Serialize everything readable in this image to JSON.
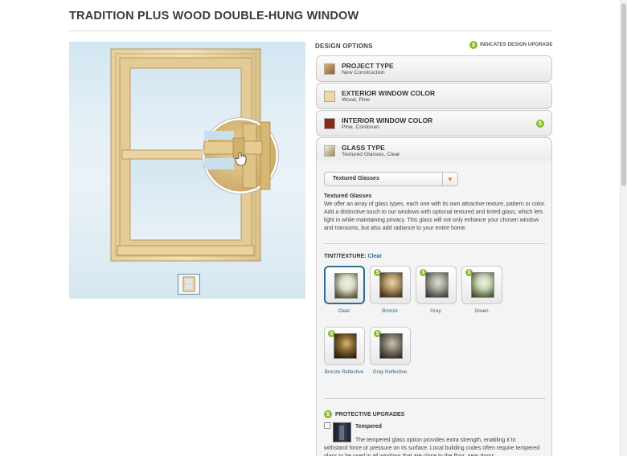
{
  "page": {
    "title": "TRADITION PLUS WOOD DOUBLE-HUNG WINDOW"
  },
  "design_options": {
    "label": "DESIGN OPTIONS",
    "upgrade_legend": "INDICATES DESIGN UPGRADE",
    "upgrade_symbol": "$"
  },
  "accordion": [
    {
      "title": "PROJECT TYPE",
      "value": "New Construction",
      "swatch": "#b48a5a",
      "upgrade": false
    },
    {
      "title": "EXTERIOR WINDOW COLOR",
      "value": "Wood, Pine",
      "swatch": "#efd7a3",
      "upgrade": false
    },
    {
      "title": "INTERIOR WINDOW COLOR",
      "value": "Pine, Cordovan",
      "swatch": "#8a2a14",
      "upgrade": true
    },
    {
      "title": "GLASS TYPE",
      "value": "Textured Glasses, Clear",
      "swatch": "#c9b884",
      "upgrade": false
    }
  ],
  "glass": {
    "select_value": "Textured Glasses",
    "heading": "Textured Glasses",
    "description": "We offer an array of glass types, each one with its own attractive texture, pattern or color. Add a distinctive touch to our windows with optional textured and tinted glass, which lets light in while maintaining privacy. This glass will not only enhance your chosen window and transoms, but also add radiance to your entire home."
  },
  "tint": {
    "label": "TINT/TEXTURE:",
    "selected": "Clear",
    "options": [
      {
        "name": "Clear",
        "upgrade": false,
        "selected": true,
        "tone": "#d9dcc9"
      },
      {
        "name": "Bronze",
        "upgrade": true,
        "selected": false,
        "tone": "#b89a6a"
      },
      {
        "name": "Gray",
        "upgrade": true,
        "selected": false,
        "tone": "#a9a9a0"
      },
      {
        "name": "Green",
        "upgrade": true,
        "selected": false,
        "tone": "#c3d4b3"
      },
      {
        "name": "Bronze Reflective",
        "upgrade": true,
        "selected": false,
        "tone": "#8a6a35"
      },
      {
        "name": "Gray Reflective",
        "upgrade": true,
        "selected": false,
        "tone": "#8a8474"
      }
    ]
  },
  "protective": {
    "label": "PROTECTIVE UPGRADES",
    "item_title": "Tempered",
    "item_line1": "The tempered glass option provides extra strength, enabling it to",
    "item_line2": "withstand force or pressure on its surface. Local building codes often require tempered glass to be used in all windows that are close to the floor, near doors,"
  }
}
